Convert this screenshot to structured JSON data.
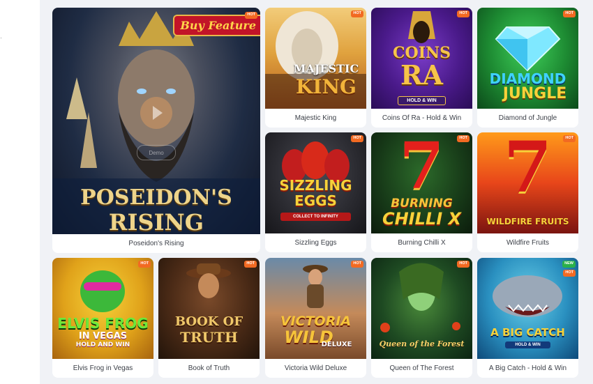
{
  "colors": {
    "hot": "#f26a22",
    "new": "#2ab04a",
    "background": "#f0f2f6"
  },
  "featured": {
    "name": "Poseidon's Rising",
    "badge": "HOT",
    "art_title_1": "POSEIDON'S",
    "art_title_2": "RISING",
    "buy_feature": "Buy Feature",
    "demo_label": "Demo"
  },
  "games": [
    {
      "name": "Majestic King",
      "badges": [
        "HOT"
      ],
      "art_1": "MAJESTIC",
      "art_2": "KING"
    },
    {
      "name": "Coins Of Ra - Hold & Win",
      "badges": [
        "HOT"
      ],
      "art_1": "COINS",
      "art_2": "RA",
      "art_3": "HOLD & WIN"
    },
    {
      "name": "Diamond of Jungle",
      "badges": [
        "HOT"
      ],
      "art_1": "DIAMOND",
      "art_2": "JUNGLE"
    },
    {
      "name": "Sizzling Eggs",
      "badges": [
        "HOT"
      ],
      "art_1": "SIZZLING",
      "art_2": "EGGS",
      "art_3": "COLLECT TO INFINITY"
    },
    {
      "name": "Burning Chilli X",
      "badges": [
        "HOT"
      ],
      "art_1": "BURNING",
      "art_2": "CHILLI X"
    },
    {
      "name": "Wildfire Fruits",
      "badges": [
        "HOT"
      ],
      "art_1": "WILDFIRE FRUITS"
    },
    {
      "name": "Elvis Frog in Vegas",
      "badges": [
        "HOT"
      ],
      "art_1": "ELVIS FROG",
      "art_2": "IN VEGAS",
      "art_3": "HOLD AND WIN"
    },
    {
      "name": "Book of Truth",
      "badges": [
        "HOT"
      ],
      "art_1": "BOOK OF",
      "art_2": "TRUTH"
    },
    {
      "name": "Victoria Wild Deluxe",
      "badges": [
        "HOT"
      ],
      "art_1": "VICTORIA",
      "art_2": "WILD",
      "art_3": "DELUXE"
    },
    {
      "name": "Queen of The Forest",
      "badges": [
        "HOT"
      ],
      "art_1": "Queen of the Forest"
    },
    {
      "name": "A Big Catch - Hold & Win",
      "badges": [
        "NEW",
        "HOT"
      ],
      "art_1": "A BIG CATCH",
      "art_2": "HOLD & WIN"
    }
  ]
}
